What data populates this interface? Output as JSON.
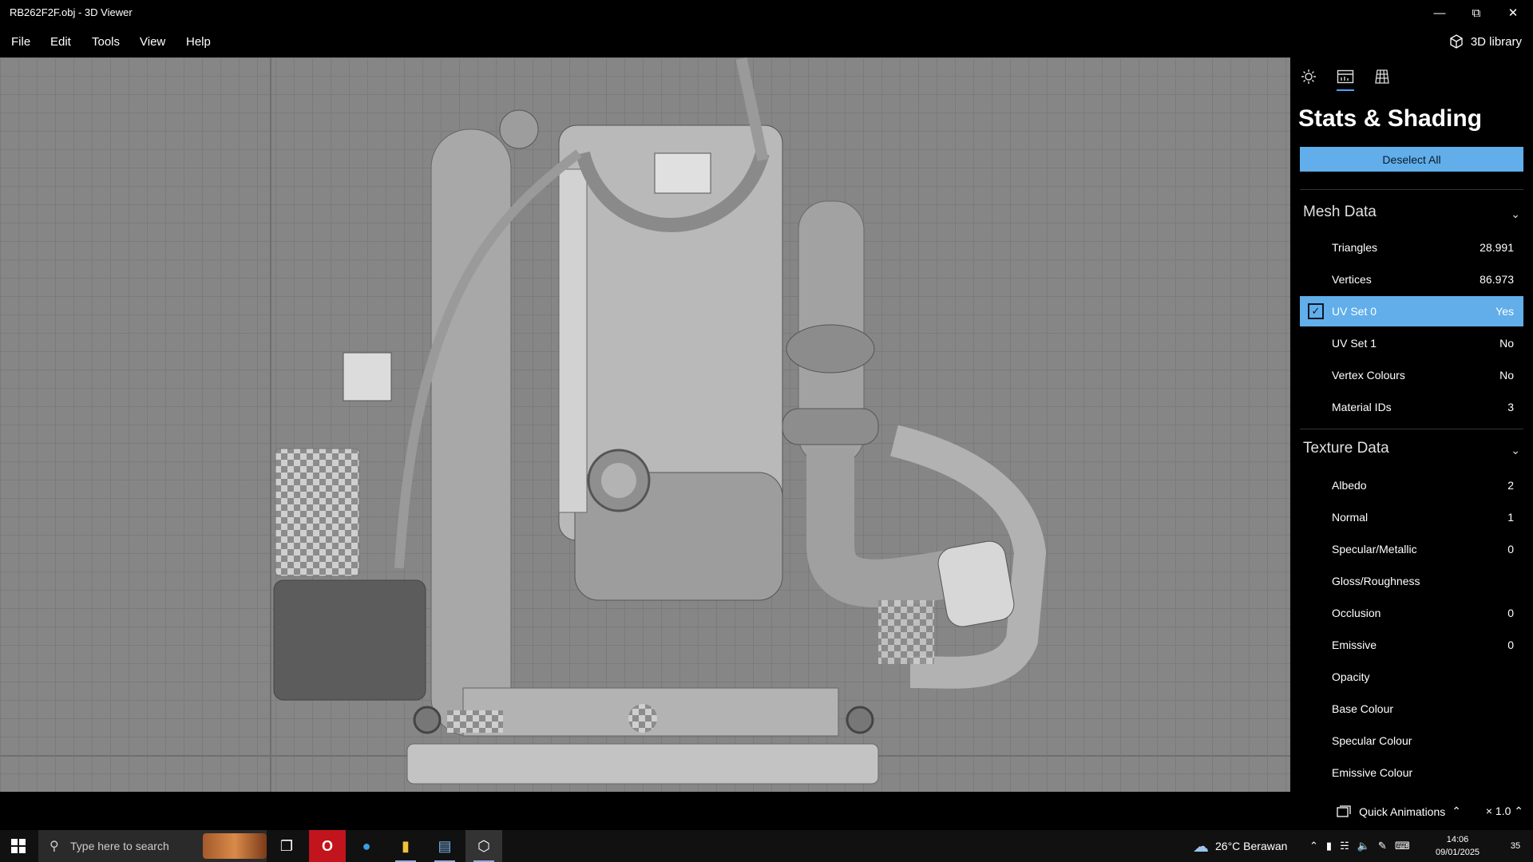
{
  "window": {
    "title": "RB262F2F.obj - 3D Viewer"
  },
  "menu": {
    "file": "File",
    "edit": "Edit",
    "tools": "Tools",
    "view": "View",
    "help": "Help",
    "library": "3D library"
  },
  "panel": {
    "title": "Stats & Shading",
    "deselect_label": "Deselect All",
    "mesh_section": "Mesh Data",
    "mesh_rows": [
      {
        "label": "Triangles",
        "value": "28.991"
      },
      {
        "label": "Vertices",
        "value": "86.973"
      },
      {
        "label": "UV Set 0",
        "value": "Yes",
        "selected": true
      },
      {
        "label": "UV Set 1",
        "value": "No"
      },
      {
        "label": "Vertex Colours",
        "value": "No"
      },
      {
        "label": "Material IDs",
        "value": "3"
      }
    ],
    "texture_section": "Texture Data",
    "texture_rows": [
      {
        "label": "Albedo",
        "value": "2"
      },
      {
        "label": "Normal",
        "value": "1"
      },
      {
        "label": "Specular/Metallic",
        "value": "0"
      },
      {
        "label": "Gloss/Roughness",
        "value": ""
      },
      {
        "label": "Occlusion",
        "value": "0"
      },
      {
        "label": "Emissive",
        "value": "0"
      },
      {
        "label": "Opacity",
        "value": ""
      },
      {
        "label": "Base Colour",
        "value": ""
      },
      {
        "label": "Specular Colour",
        "value": ""
      },
      {
        "label": "Emissive Colour",
        "value": ""
      }
    ]
  },
  "bottom": {
    "quick_animations": "Quick Animations",
    "zoom": "× 1.0"
  },
  "taskbar": {
    "search_placeholder": "Type here to search",
    "weather": "26°C Berawan",
    "time": "14:06",
    "date": "09/01/2025",
    "notifications": "35"
  },
  "colors": {
    "accent": "#61aeea",
    "viewport": "#868686"
  }
}
